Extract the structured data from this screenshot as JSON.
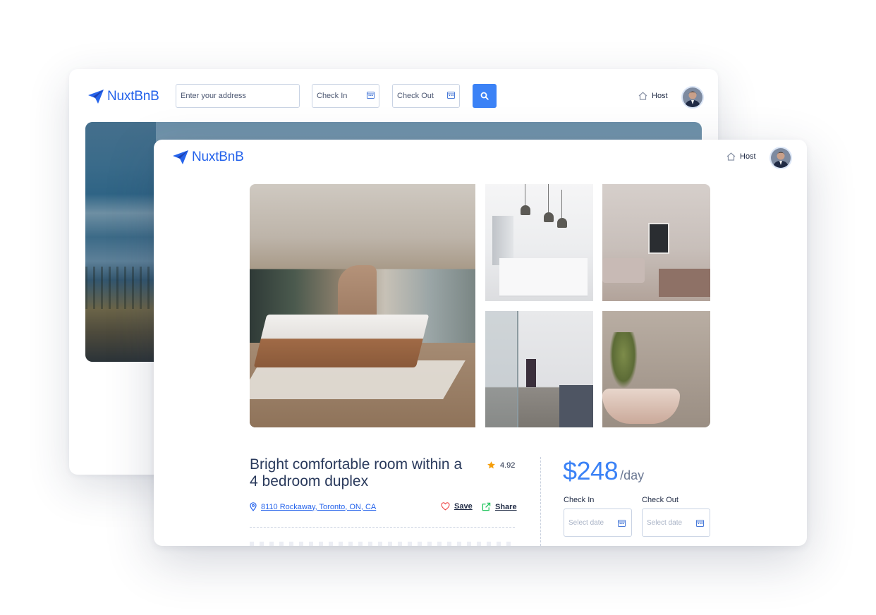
{
  "back_window": {
    "brand": "NuxtBnB",
    "search": {
      "address_placeholder": "Enter your address",
      "check_in": "Check In",
      "check_out": "Check Out"
    },
    "nav": {
      "host_label": "Host"
    }
  },
  "front_window": {
    "brand": "NuxtBnB",
    "nav": {
      "host_label": "Host"
    },
    "listing": {
      "title": "Bright comfortable room within a 4 bedroom duplex",
      "rating": "4.92",
      "address": "8110 Rockaway, Toronto, ON, CA",
      "save_label": "Save",
      "share_label": "Share",
      "price": "$248",
      "price_unit": "/day",
      "check_in_label": "Check In",
      "check_out_label": "Check Out",
      "check_in_placeholder": "Select date",
      "check_out_placeholder": "Select date"
    }
  },
  "colors": {
    "brand_blue": "#2563eb",
    "accent_blue": "#3b82f6",
    "star": "#f59e0b",
    "heart": "#ef4444",
    "share_green": "#22c55e"
  }
}
